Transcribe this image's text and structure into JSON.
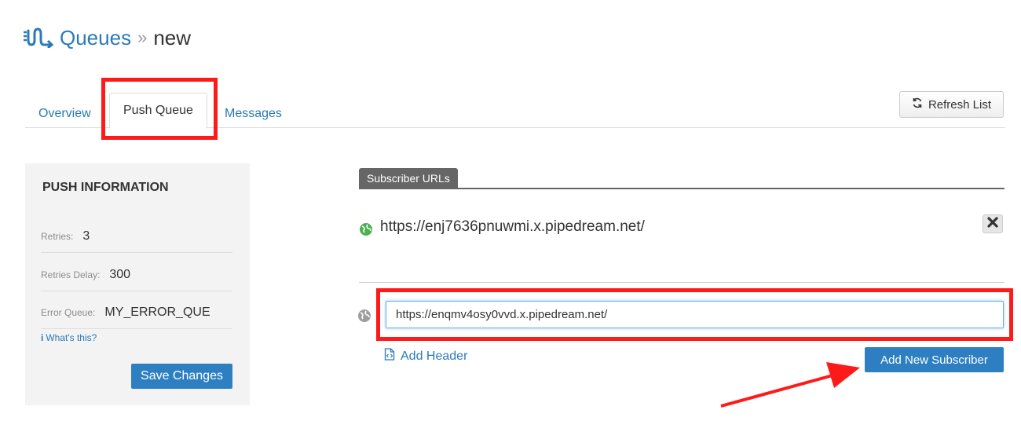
{
  "header": {
    "breadcrumb_link": "Queues",
    "separator": "»",
    "current": "new"
  },
  "tabs": [
    {
      "label": "Overview",
      "active": false
    },
    {
      "label": "Push Queue",
      "active": true
    },
    {
      "label": "Messages",
      "active": false
    }
  ],
  "toolbar": {
    "refresh_label": "Refresh List",
    "refresh_icon": "refresh-icon"
  },
  "push_info": {
    "title": "PUSH INFORMATION",
    "retries": {
      "label": "Retries:",
      "value": "3"
    },
    "retries_delay": {
      "label": "Retries Delay:",
      "value": "300"
    },
    "error_queue": {
      "label": "Error Queue:",
      "value": "MY_ERROR_QUE"
    },
    "whats_this_icon": "i",
    "whats_this": "What's this?",
    "save_label": "Save Changes"
  },
  "subscribers": {
    "section_title": "Subscriber URLs",
    "items": [
      {
        "url": "https://enj7636pnuwmi.x.pipedream.net/"
      }
    ],
    "new_url_value": "https://enqmv4osy0vvd.x.pipedream.net/",
    "add_header_label": "Add Header",
    "add_subscriber_label": "Add New Subscriber"
  },
  "colors": {
    "link": "#2a7ab8",
    "primary_button": "#2d7fc1",
    "highlight": "#ff1a1a",
    "globe_active": "#4caf50",
    "globe_inactive": "#9e9e9e"
  }
}
